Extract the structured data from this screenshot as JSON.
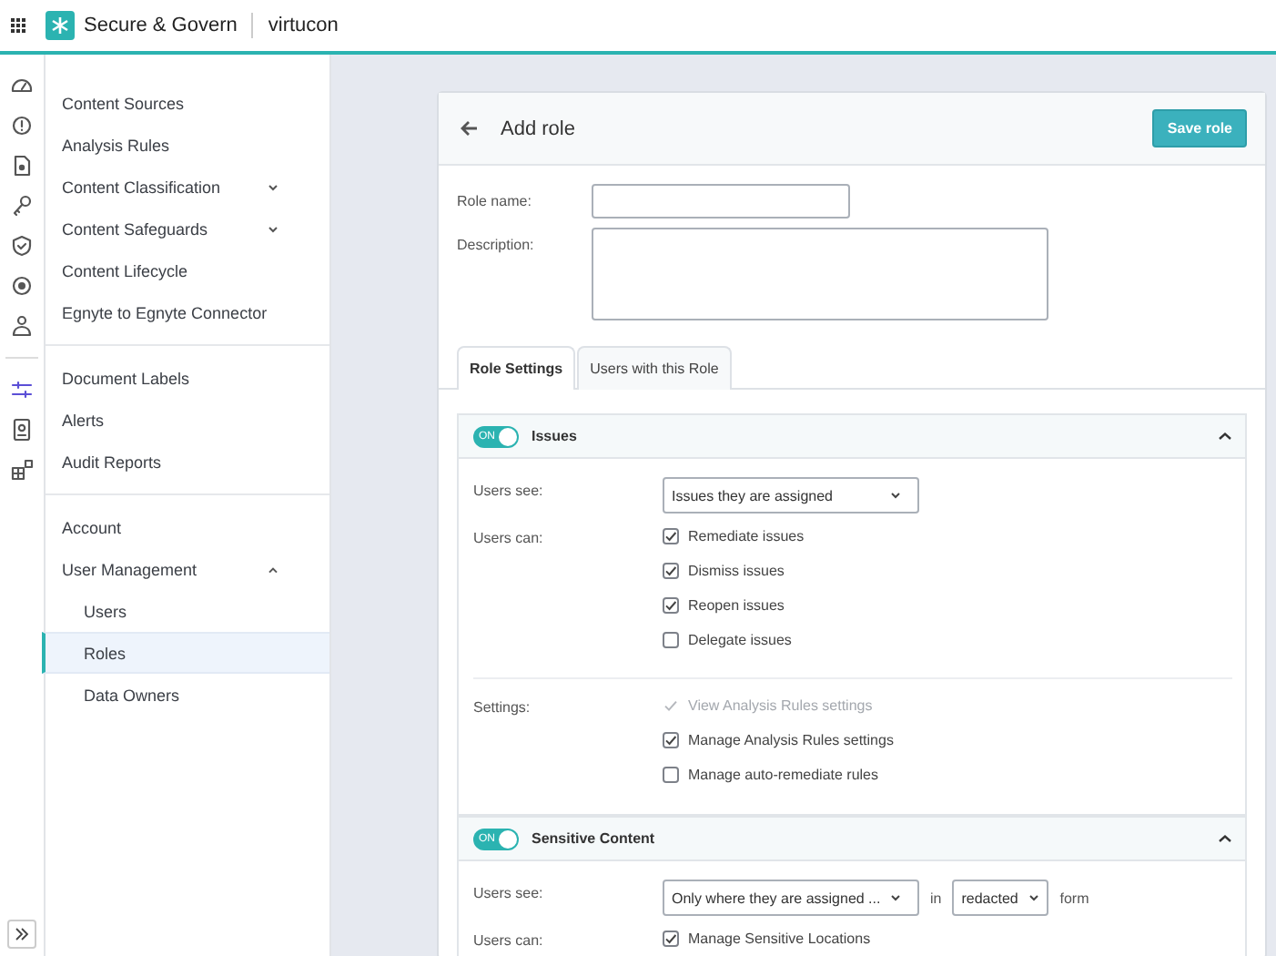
{
  "topbar": {
    "app_name": "Secure & Govern",
    "tenant": "virtucon"
  },
  "rail": {
    "groups": [
      {
        "items": [
          {
            "kind": "gauge",
            "selected": false
          },
          {
            "kind": "alert",
            "selected": false
          },
          {
            "kind": "document",
            "selected": false
          },
          {
            "kind": "key",
            "selected": false
          },
          {
            "kind": "shield",
            "selected": false
          },
          {
            "kind": "target",
            "selected": false
          },
          {
            "kind": "person",
            "selected": false
          }
        ]
      },
      {
        "items": [
          {
            "kind": "sliders",
            "selected": true
          },
          {
            "kind": "badge",
            "selected": false
          },
          {
            "kind": "blocks",
            "selected": false
          }
        ]
      }
    ]
  },
  "sidebar": {
    "groups": [
      {
        "items": [
          {
            "label": "Content Sources",
            "kind": "link",
            "selected": false
          },
          {
            "label": "Analysis Rules",
            "kind": "link",
            "selected": false
          },
          {
            "label": "Content Classification",
            "kind": "group",
            "expanded": false,
            "selected": false
          },
          {
            "label": "Content Safeguards",
            "kind": "group",
            "expanded": false,
            "selected": false
          },
          {
            "label": "Content Lifecycle",
            "kind": "link",
            "selected": false
          },
          {
            "label": "Egnyte to Egnyte Connector",
            "kind": "link",
            "selected": false
          }
        ]
      },
      {
        "items": [
          {
            "label": "Document Labels",
            "kind": "link",
            "selected": false
          },
          {
            "label": "Alerts",
            "kind": "link",
            "selected": false
          },
          {
            "label": "Audit Reports",
            "kind": "link",
            "selected": false
          }
        ]
      },
      {
        "items": [
          {
            "label": "Account",
            "kind": "link",
            "selected": false
          },
          {
            "label": "User Management",
            "kind": "group",
            "expanded": true,
            "selected": false,
            "children": [
              {
                "label": "Users",
                "selected": false
              },
              {
                "label": "Roles",
                "selected": true
              },
              {
                "label": "Data Owners",
                "selected": false
              }
            ]
          }
        ]
      }
    ]
  },
  "card": {
    "title": "Add role",
    "save_button": "Save role",
    "fields": [
      {
        "label": "Role name:",
        "kind": "text"
      },
      {
        "label": "Description:",
        "kind": "textarea"
      }
    ],
    "tabs": [
      {
        "label": "Role Settings",
        "selected": true
      },
      {
        "label": "Users with this Role",
        "selected": false
      }
    ],
    "sections": [
      {
        "title": "Issues",
        "toggle_label": "ON",
        "on": true,
        "expanded": true,
        "groups": [
          {
            "rows": [
              {
                "label": "Users see:",
                "parts": [
                  {
                    "kind": "select",
                    "value": "Issues they are assigned"
                  }
                ]
              },
              {
                "label": "Users can:",
                "options": [
                  {
                    "label": "Remediate issues",
                    "checked": true,
                    "disabled": false
                  },
                  {
                    "label": "Dismiss issues",
                    "checked": true,
                    "disabled": false
                  },
                  {
                    "label": "Reopen issues",
                    "checked": true,
                    "disabled": false
                  },
                  {
                    "label": "Delegate issues",
                    "checked": false,
                    "disabled": false
                  }
                ]
              }
            ]
          },
          {
            "rows": [
              {
                "label": "Settings:",
                "options": [
                  {
                    "label": "View Analysis Rules settings",
                    "checked": true,
                    "disabled": true
                  },
                  {
                    "label": "Manage Analysis Rules settings",
                    "checked": true,
                    "disabled": false
                  },
                  {
                    "label": "Manage auto-remediate rules",
                    "checked": false,
                    "disabled": false
                  }
                ]
              }
            ]
          }
        ]
      },
      {
        "title": "Sensitive Content",
        "toggle_label": "ON",
        "on": true,
        "expanded": true,
        "groups": [
          {
            "rows": [
              {
                "label": "Users see:",
                "parts": [
                  {
                    "kind": "select",
                    "value": "Only where they are assigned ..."
                  },
                  {
                    "kind": "text",
                    "value": "in"
                  },
                  {
                    "kind": "compact-select",
                    "value": "redacted"
                  },
                  {
                    "kind": "text",
                    "value": "form"
                  }
                ]
              },
              {
                "label": "Users can:",
                "options": [
                  {
                    "label": "Manage Sensitive Locations",
                    "checked": true,
                    "disabled": false
                  }
                ]
              }
            ]
          }
        ]
      }
    ]
  }
}
